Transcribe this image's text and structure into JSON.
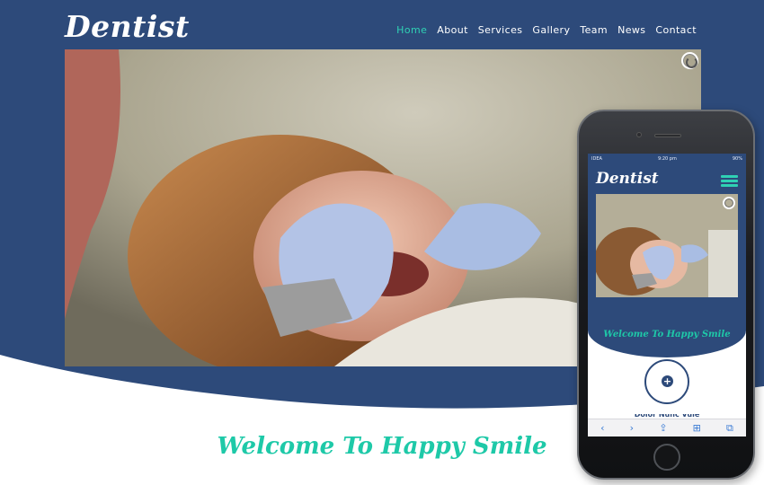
{
  "header": {
    "logo": "Dentist",
    "nav": [
      "Home",
      "About",
      "Services",
      "Gallery",
      "Team",
      "News",
      "Contact"
    ],
    "active_nav": "Home"
  },
  "hero": {
    "image": "dental-checkup-photo",
    "loader_icon": "slider-loader-icon"
  },
  "welcome": {
    "heading": "Welcome To Happy Smile"
  },
  "phone": {
    "status": {
      "carrier": "IDEA",
      "time": "9:20 pm",
      "battery": "90%"
    },
    "logo": "Dentist",
    "menu_icon": "hamburger-menu-icon",
    "welcome": "Welcome To Happy Smile",
    "cut_text": "Dolor Nunc Vule",
    "toolbar": [
      "‹",
      "›",
      "⇪",
      "⊞",
      "⧉"
    ]
  },
  "colors": {
    "navy": "#2d4a7a",
    "accent": "#2fd1b4",
    "heading": "#1ec9a8",
    "white": "#ffffff"
  }
}
